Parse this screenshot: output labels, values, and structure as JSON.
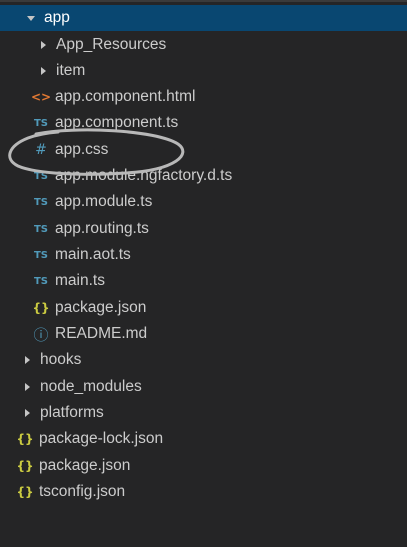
{
  "explorer": {
    "items": [
      {
        "label": "app",
        "icon": "chevron-down",
        "selected": true
      },
      {
        "label": "App_Resources",
        "icon": "chevron-right"
      },
      {
        "label": "item",
        "icon": "chevron-right"
      },
      {
        "label": "app.component.html",
        "icon": "html-file",
        "glyph": "<>"
      },
      {
        "label": "app.component.ts",
        "icon": "typescript-file",
        "glyph": "TS"
      },
      {
        "label": "app.css",
        "icon": "css-file",
        "glyph": "#"
      },
      {
        "label": "app.module.ngfactory.d.ts",
        "icon": "typescript-file",
        "glyph": "TS"
      },
      {
        "label": "app.module.ts",
        "icon": "typescript-file",
        "glyph": "TS"
      },
      {
        "label": "app.routing.ts",
        "icon": "typescript-file",
        "glyph": "TS"
      },
      {
        "label": "main.aot.ts",
        "icon": "typescript-file",
        "glyph": "TS"
      },
      {
        "label": "main.ts",
        "icon": "typescript-file",
        "glyph": "TS"
      },
      {
        "label": "package.json",
        "icon": "json-file",
        "glyph": "{}"
      },
      {
        "label": "README.md",
        "icon": "info-file",
        "glyph": "ⓘ"
      },
      {
        "label": "hooks",
        "icon": "chevron-right"
      },
      {
        "label": "node_modules",
        "icon": "chevron-right"
      },
      {
        "label": "platforms",
        "icon": "chevron-right"
      },
      {
        "label": "package-lock.json",
        "icon": "json-file",
        "glyph": "{}"
      },
      {
        "label": "package.json",
        "icon": "json-file",
        "glyph": "{}"
      },
      {
        "label": "tsconfig.json",
        "icon": "json-file",
        "glyph": "{}"
      }
    ]
  },
  "colors": {
    "background": "#252526",
    "selection": "#094771",
    "text": "#cccccc",
    "ts_icon": "#519aba",
    "json_icon": "#cbcb41",
    "html_icon": "#e37933",
    "annotation": "#b8b8b8"
  }
}
